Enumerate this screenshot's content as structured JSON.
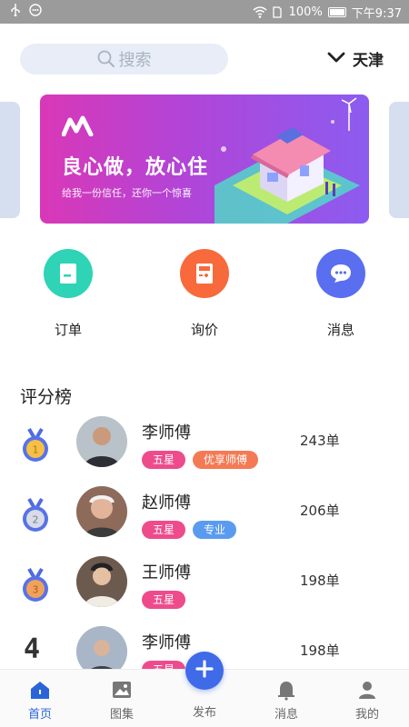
{
  "status_bar": {
    "battery": "100%",
    "time": "下午9:37"
  },
  "search": {
    "placeholder": "搜索",
    "city": "天津"
  },
  "banner": {
    "title": "良心做，放心住",
    "subtitle": "给我一份信任，还你一个惊喜"
  },
  "quick_actions": [
    {
      "label": "订单",
      "color": "#2fd3b5"
    },
    {
      "label": "询价",
      "color": "#f86a3c"
    },
    {
      "label": "消息",
      "color": "#5a6ef0"
    }
  ],
  "ranking": {
    "title": "评分榜",
    "items": [
      {
        "rank": "1",
        "name": "李师傅",
        "tags": [
          "五星",
          "优享师傅"
        ],
        "orders": "243单"
      },
      {
        "rank": "2",
        "name": "赵师傅",
        "tags": [
          "五星",
          "专业"
        ],
        "orders": "206单"
      },
      {
        "rank": "3",
        "name": "王师傅",
        "tags": [
          "五星"
        ],
        "orders": "198单"
      },
      {
        "rank": "4",
        "name": "李师傅",
        "tags": [
          "五星"
        ],
        "orders": "198单"
      }
    ]
  },
  "tabbar": {
    "home": "首页",
    "gallery": "图集",
    "publish": "发布",
    "messages": "消息",
    "mine": "我的"
  },
  "colors": {
    "accent": "#3f6ae8",
    "tag_star": "#ee4b8c",
    "tag_premium": "#f47a55",
    "tag_pro": "#5a9bf0"
  }
}
